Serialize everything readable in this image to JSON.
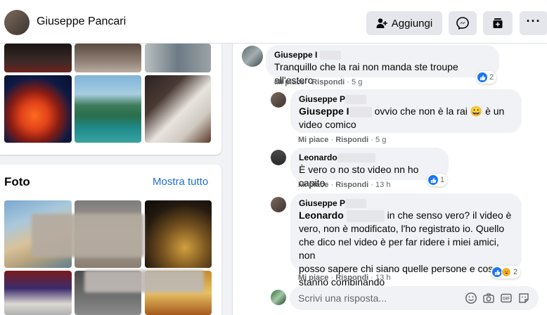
{
  "profile": {
    "name": "Giuseppe Pancari",
    "add_friend_label": "Aggiungi"
  },
  "photos": {
    "title": "Foto",
    "see_all": "Mostra tutto"
  },
  "comments": [
    {
      "author": "Giuseppe I",
      "text": "Tranquillo che la rai non manda ste troupe all'estero",
      "like": "Mi piace",
      "reply": "Rispondi",
      "time": "5 g",
      "reactions": "2"
    },
    {
      "author": "Giuseppe P",
      "mention": "Giuseppe I",
      "text_line1": "ovvio che non è la rai 😀 è un",
      "text_line2": "video comico",
      "like": "Mi piace",
      "reply": "Rispondi",
      "time": "5 g"
    },
    {
      "author": "Leonardo",
      "text": "È vero o no sto video nn ho capito",
      "like": "Mi piace",
      "reply": "Rispondi",
      "time": "13 h",
      "reactions": "1"
    },
    {
      "author": "Giuseppe P",
      "mention": "Leonardo",
      "text_line1": "in che senso vero? il video è",
      "text_line2": "vero, non è modificato, l'ho registrato io. Quello",
      "text_line3": "che dico nel video è per far ridere i miei amici, non",
      "text_line4": "posso sapere chi siano quelle persone e cosa",
      "text_line5": "stanno combinando",
      "like": "Mi piace",
      "reply": "Rispondi",
      "time": "13 h",
      "reactions": "2"
    }
  ],
  "reply_input": {
    "placeholder": "Scrivi una risposta..."
  },
  "colors": {
    "link_blue": "#216fdb",
    "like_blue": "#1877f2",
    "bubble_bg": "#f0f2f5"
  }
}
